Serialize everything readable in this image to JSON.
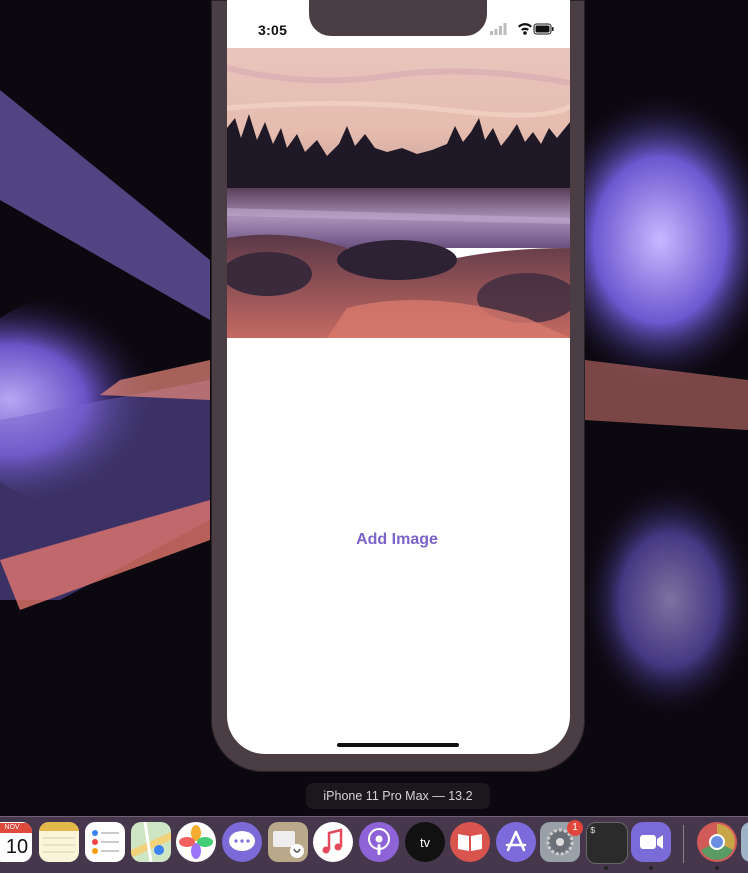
{
  "status_bar": {
    "time": "3:05"
  },
  "main": {
    "add_image_label": "Add Image"
  },
  "simulator": {
    "device_label": "iPhone 11 Pro Max — 13.2"
  },
  "dock": {
    "calendar": {
      "month": "NOV",
      "day": "10"
    },
    "app_store_badge_count": "1",
    "items": [
      "calendar-icon",
      "notes-icon",
      "reminders-icon",
      "maps-icon",
      "photos-icon",
      "messages-icon",
      "facetime-icon",
      "music-icon",
      "podcasts-icon",
      "tv-icon",
      "books-icon",
      "app-store-icon",
      "system-preferences-icon",
      "terminal-icon",
      "zoom-icon",
      "chrome-icon"
    ],
    "tv_label": "tv",
    "terminal_prompt": "$"
  },
  "colors": {
    "accent": "#7b63c8",
    "device_frame": "#4a3d43"
  }
}
